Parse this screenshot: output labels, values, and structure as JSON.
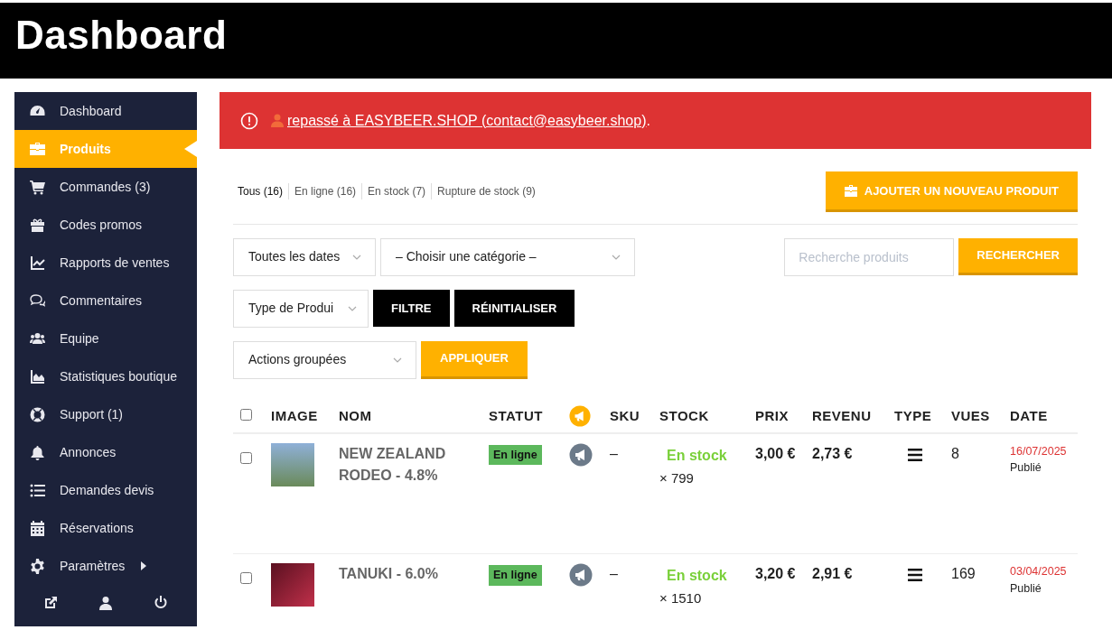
{
  "header": {
    "title": "Dashboard"
  },
  "sidebar": {
    "items": [
      {
        "label": "Dashboard",
        "selected": false,
        "has_submenu": false
      },
      {
        "label": "Produits",
        "selected": true,
        "has_submenu": false
      },
      {
        "label": "Commandes (3)",
        "selected": false,
        "has_submenu": false
      },
      {
        "label": "Codes promos",
        "selected": false,
        "has_submenu": false
      },
      {
        "label": "Rapports de ventes",
        "selected": false,
        "has_submenu": false
      },
      {
        "label": "Commentaires",
        "selected": false,
        "has_submenu": false
      },
      {
        "label": "Equipe",
        "selected": false,
        "has_submenu": false
      },
      {
        "label": "Statistiques boutique",
        "selected": false,
        "has_submenu": false
      },
      {
        "label": "Support (1)",
        "selected": false,
        "has_submenu": false
      },
      {
        "label": "Annonces",
        "selected": false,
        "has_submenu": false
      },
      {
        "label": "Demandes devis",
        "selected": false,
        "has_submenu": false
      },
      {
        "label": "Réservations",
        "selected": false,
        "has_submenu": false
      },
      {
        "label": "Paramètres",
        "selected": false,
        "has_submenu": true
      }
    ]
  },
  "alert": {
    "link": "repassé à EASYBEER.SHOP (contact@easybeer.shop)",
    "tail": "."
  },
  "status_tabs": [
    {
      "label": "Tous (16)",
      "selected": true
    },
    {
      "label": "En ligne (16)",
      "selected": false
    },
    {
      "label": "En stock (7)",
      "selected": false
    },
    {
      "label": "Rupture de stock (9)",
      "selected": false
    }
  ],
  "add_button": "AJOUTER UN NOUVEAU PRODUIT",
  "filters": {
    "date_select": "Toutes les dates",
    "category_select": "– Choisir une catégorie –",
    "search": {
      "placeholder": "Recherche produits"
    },
    "search_button": "RECHERCHER",
    "type_select": "Type de Produi",
    "filter_button": "FILTRE",
    "reset_button": "RÉINITIALISER",
    "bulk_select": "Actions groupées",
    "apply_button": "APPLIQUER"
  },
  "table": {
    "columns": [
      {
        "kind": "checkbox",
        "checked": false
      },
      {
        "kind": "text",
        "label": "IMAGE"
      },
      {
        "kind": "text",
        "label": "NOM"
      },
      {
        "kind": "text",
        "label": "STATUT"
      },
      {
        "kind": "icon"
      },
      {
        "kind": "text",
        "label": "SKU"
      },
      {
        "kind": "text",
        "label": "STOCK"
      },
      {
        "kind": "text",
        "label": "PRIX"
      },
      {
        "kind": "text",
        "label": "REVENU"
      },
      {
        "kind": "text",
        "label": "TYPE"
      },
      {
        "kind": "text",
        "label": "VUES"
      },
      {
        "kind": "text",
        "label": "DATE"
      }
    ],
    "rows": [
      {
        "checked": false,
        "name": "NEW ZEALAND RODEO - 4.8%",
        "status": "En ligne",
        "sku": "–",
        "stock_status": "En stock",
        "stock_qty": "× 799",
        "price": "3,00 €",
        "revenue": "2,73 €",
        "views": "8",
        "date": "16/07/2025",
        "published": "Publié"
      },
      {
        "checked": false,
        "name": "TANUKI - 6.0%",
        "status": "En ligne",
        "sku": "–",
        "stock_status": "En stock",
        "stock_qty": "× 1510",
        "price": "3,20 €",
        "revenue": "2,91 €",
        "views": "169",
        "date": "03/04/2025",
        "published": "Publié"
      }
    ]
  }
}
